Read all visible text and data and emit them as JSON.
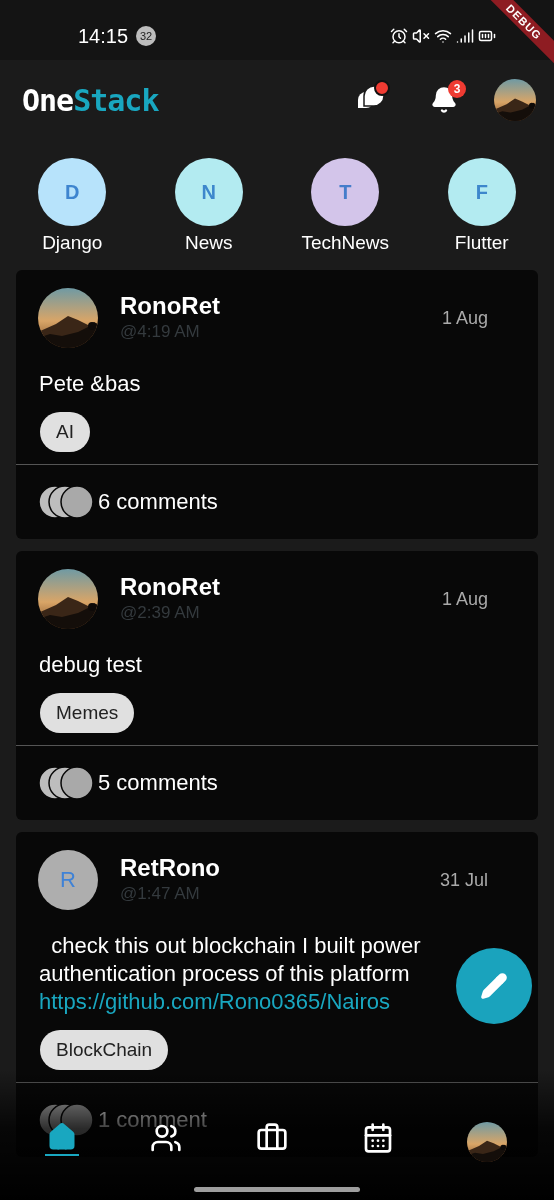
{
  "status_bar": {
    "time": "14:15",
    "notification_count": "32"
  },
  "debug_banner": {
    "label": "DEBUG"
  },
  "app_bar": {
    "logo_parts": [
      "One",
      "Stack"
    ],
    "chat_unread": true,
    "notification_badge": "3"
  },
  "communities": [
    {
      "letter": "D",
      "name": "Django",
      "color": "#b7e3fb"
    },
    {
      "letter": "N",
      "name": "News",
      "color": "#b3ebf1"
    },
    {
      "letter": "T",
      "name": "TechNews",
      "color": "#d3c5ea"
    },
    {
      "letter": "F",
      "name": "Flutter",
      "color": "#b3ebf1"
    }
  ],
  "posts": [
    {
      "author": "RonoRet",
      "time": "@4:19 AM",
      "date": "1 Aug",
      "avatar": {
        "kind": "picture"
      },
      "body": "Pete &bas",
      "tags": [
        "AI"
      ],
      "comments": "6 comments"
    },
    {
      "author": "RonoRet",
      "time": "@2:39 AM",
      "date": "1 Aug",
      "avatar": {
        "kind": "picture"
      },
      "body": "debug test",
      "tags": [
        "Memes"
      ],
      "comments": "5 comments"
    },
    {
      "author": "RetRono",
      "time": "@1:47 AM",
      "date": "31 Jul",
      "avatar": {
        "kind": "letter",
        "letter": "R"
      },
      "body": "  check this out blockchain I built power authentication process of this platform",
      "link": "https://github.com/Rono0365/Nairos",
      "tags": [
        "BlockChain"
      ],
      "comments": "1 comment"
    }
  ],
  "bottom_nav": [
    {
      "kind": "home",
      "selected": true
    },
    {
      "kind": "people",
      "selected": false
    },
    {
      "kind": "briefcase",
      "selected": false
    },
    {
      "kind": "calendar",
      "selected": false
    },
    {
      "kind": "avatar",
      "selected": false
    }
  ]
}
